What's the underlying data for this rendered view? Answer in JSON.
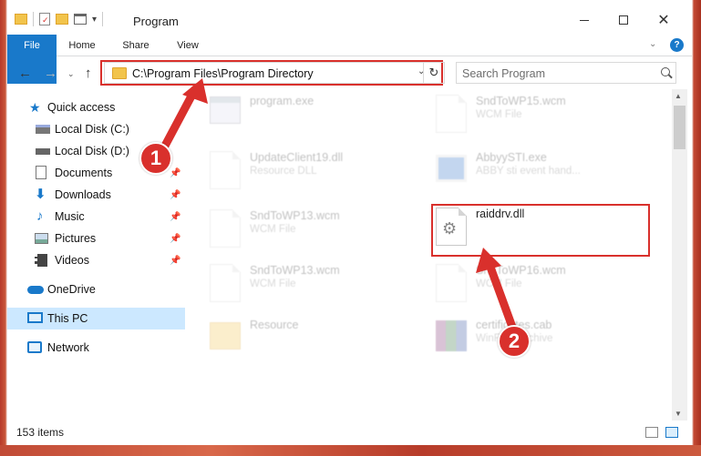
{
  "window": {
    "title": "Program",
    "qat_dropdown": "▾"
  },
  "ribbon": {
    "tabs": [
      "File",
      "Home",
      "Share",
      "View"
    ]
  },
  "navigation": {
    "address_path": "C:\\Program Files\\Program Directory",
    "search_placeholder": "Search Program"
  },
  "sidebar": {
    "items": [
      {
        "label": "Quick access",
        "icon": "star-icon"
      },
      {
        "label": "Local Disk (C:)",
        "icon": "drive-icon"
      },
      {
        "label": "Local Disk (D:)",
        "icon": "drive-icon"
      },
      {
        "label": "Documents",
        "icon": "documents-icon"
      },
      {
        "label": "Downloads",
        "icon": "download-icon"
      },
      {
        "label": "Music",
        "icon": "music-icon"
      },
      {
        "label": "Pictures",
        "icon": "pictures-icon"
      },
      {
        "label": "Videos",
        "icon": "videos-icon"
      },
      {
        "label": "OneDrive",
        "icon": "cloud-icon"
      },
      {
        "label": "This PC",
        "icon": "computer-icon"
      },
      {
        "label": "Network",
        "icon": "network-icon"
      }
    ],
    "selected": "This PC"
  },
  "files": [
    {
      "name": "program.exe",
      "type": ""
    },
    {
      "name": "SndToWP15.wcm",
      "type": "WCM File"
    },
    {
      "name": "UpdateClient19.dll",
      "type": "Resource DLL"
    },
    {
      "name": "AbbyySTI.exe",
      "type": "ABBY sti event hand..."
    },
    {
      "name": "SndToWP13.wcm",
      "type": "WCM File"
    },
    {
      "name": "raiddrv.dll",
      "type": ""
    },
    {
      "name": "SndToWP13.wcm",
      "type": "WCM File"
    },
    {
      "name": "SndToWP16.wcm",
      "type": "WCM File"
    },
    {
      "name": "Resource",
      "type": ""
    },
    {
      "name": "certificates.cab",
      "type": "WinRAR archive"
    }
  ],
  "status": {
    "item_count": "153 items"
  },
  "annotations": {
    "step1": "1",
    "step2": "2"
  },
  "colors": {
    "accent": "#1979ca",
    "highlight": "#d9302c",
    "selected_bg": "#cce8ff"
  }
}
